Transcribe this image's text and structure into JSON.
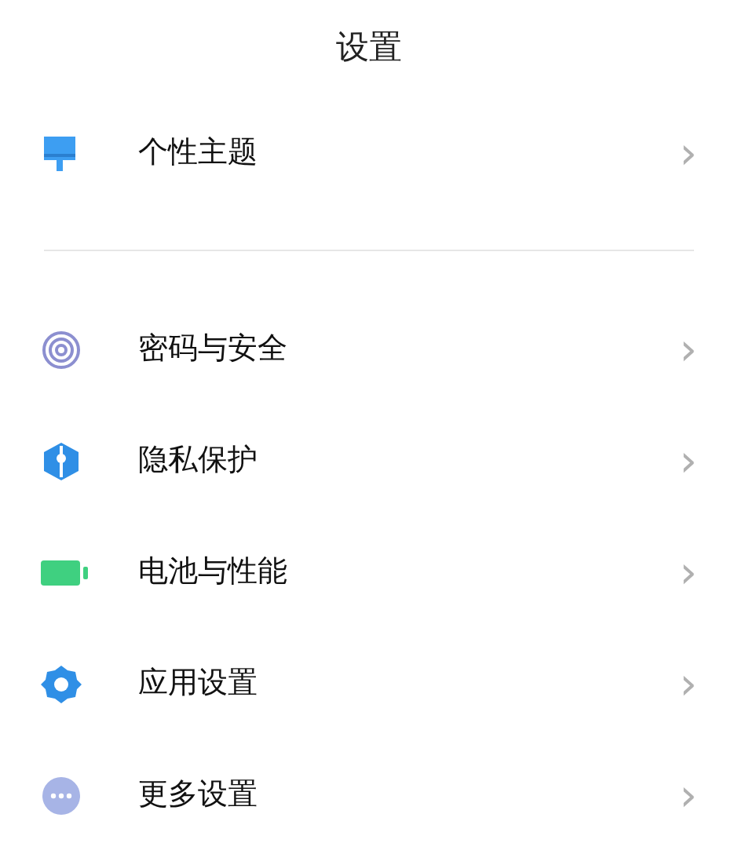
{
  "title": "设置",
  "sections": [
    {
      "items": [
        {
          "kind": "brush",
          "label": "个性主题",
          "chevron": "›"
        }
      ]
    },
    {
      "items": [
        {
          "kind": "fingerprint",
          "label": "密码与安全",
          "chevron": "›"
        },
        {
          "kind": "shield",
          "label": "隐私保护",
          "chevron": "›"
        },
        {
          "kind": "battery",
          "label": "电池与性能",
          "chevron": "›"
        },
        {
          "kind": "gear",
          "label": "应用设置",
          "chevron": "›"
        },
        {
          "kind": "more",
          "label": "更多设置",
          "chevron": "›"
        }
      ]
    }
  ]
}
